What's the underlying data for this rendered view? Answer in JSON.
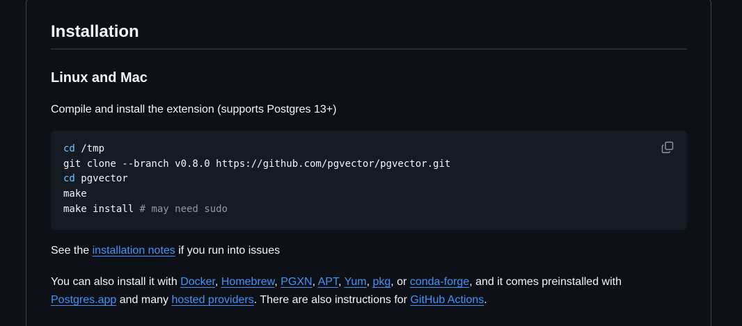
{
  "section": {
    "title": "Installation",
    "subtitle": "Linux and Mac",
    "intro": "Compile and install the extension (supports Postgres 13+)"
  },
  "code": {
    "lines": [
      {
        "kw": "cd",
        "rest": " /tmp",
        "comment": ""
      },
      {
        "kw": "",
        "rest": "git clone --branch v0.8.0 https://github.com/pgvector/pgvector.git",
        "comment": ""
      },
      {
        "kw": "cd",
        "rest": " pgvector",
        "comment": ""
      },
      {
        "kw": "",
        "rest": "make",
        "comment": ""
      },
      {
        "kw": "",
        "rest": "make install ",
        "comment": "# may need sudo"
      }
    ],
    "copy_icon": "copy-icon"
  },
  "notes": {
    "prefix": "See the ",
    "link": "installation notes",
    "suffix": " if you run into issues"
  },
  "also": {
    "t1": "You can also install it with ",
    "docker": "Docker",
    "c1": ", ",
    "homebrew": "Homebrew",
    "c2": ", ",
    "pgxn": "PGXN",
    "c3": ", ",
    "apt": "APT",
    "c4": ", ",
    "yum": "Yum",
    "c5": ", ",
    "pkg": "pkg",
    "c6": ", or ",
    "conda": "conda-forge",
    "t2": ", and it comes preinstalled with ",
    "postgresapp": "Postgres.app",
    "t3": " and many ",
    "hosted": "hosted providers",
    "t4": ". There are also instructions for ",
    "gha": "GitHub Actions",
    "t5": "."
  },
  "colors": {
    "background": "#0d1117",
    "code_background": "#151b23",
    "link": "#4493f8",
    "keyword": "#79c0ff",
    "comment": "#9198a1",
    "border": "#3d444d"
  }
}
